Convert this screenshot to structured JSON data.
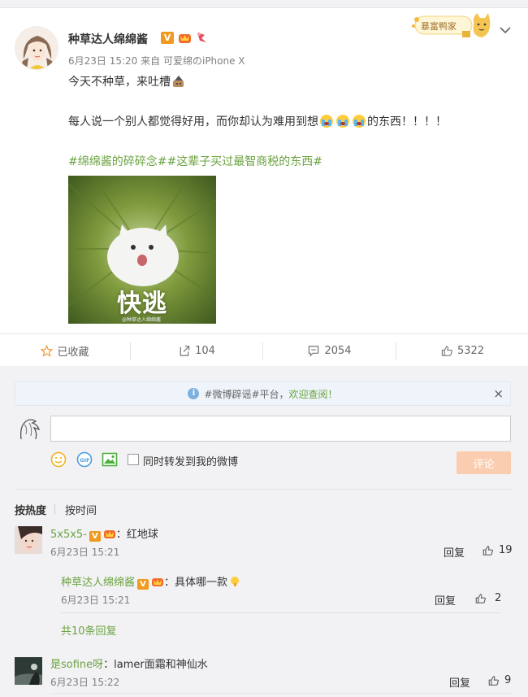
{
  "post": {
    "author": "种草达人绵绵酱",
    "v_badge": "V",
    "timestamp": "6月23日 15:20",
    "source_prefix": "来自",
    "source": "可爱绵のiPhone X",
    "line1": "今天不种草，来吐槽",
    "line2_before": "每人说一个别人都觉得好用，而你却认为难用到想",
    "line2_after": "的东西！！！！",
    "topics": "#绵绵酱的碎碎念##这辈子买过最智商税的东西#",
    "image_caption": "快逃",
    "image_credit": "@种草达人绵绵酱",
    "decor_card_text": "暴富鸭家"
  },
  "actions": {
    "favorite": "已收藏",
    "forward_count": "104",
    "comment_count": "2054",
    "like_count": "5322"
  },
  "notice": {
    "prefix": "#微博辟谣#平台，",
    "link": "欢迎查阅！",
    "close": "×"
  },
  "compose": {
    "input_value": "",
    "also_forward_label": "同时转发到我的微博",
    "submit_label": "评论"
  },
  "sort": {
    "by_hot": "按热度",
    "by_time": "按时间"
  },
  "comments": [
    {
      "user": "5x5x5-",
      "v_badge": "V",
      "text": "：红地球",
      "time": "6月23日 15:21",
      "reply_label": "回复",
      "likes": "19",
      "replies": [
        {
          "user": "种草达人绵绵酱",
          "v_badge": "V",
          "text": "：具体哪一款",
          "time": "6月23日 15:21",
          "reply_label": "回复",
          "likes": "2"
        }
      ],
      "more_replies": "共10条回复"
    },
    {
      "user": "是sofine呀",
      "text": "：lamer面霜和神仙水",
      "time": "6月23日 15:22",
      "reply_label": "回复",
      "likes": "9"
    }
  ],
  "colors": {
    "link_green": "#6aa33f",
    "v_orange": "#f09a1f",
    "submit_disabled": "#fbcdb0"
  },
  "icons": [
    "star-icon",
    "forward-icon",
    "comment-icon",
    "thumbs-up-icon",
    "smiley-icon",
    "gif-icon",
    "image-icon",
    "info-icon",
    "close-icon",
    "chevron-down-icon"
  ]
}
